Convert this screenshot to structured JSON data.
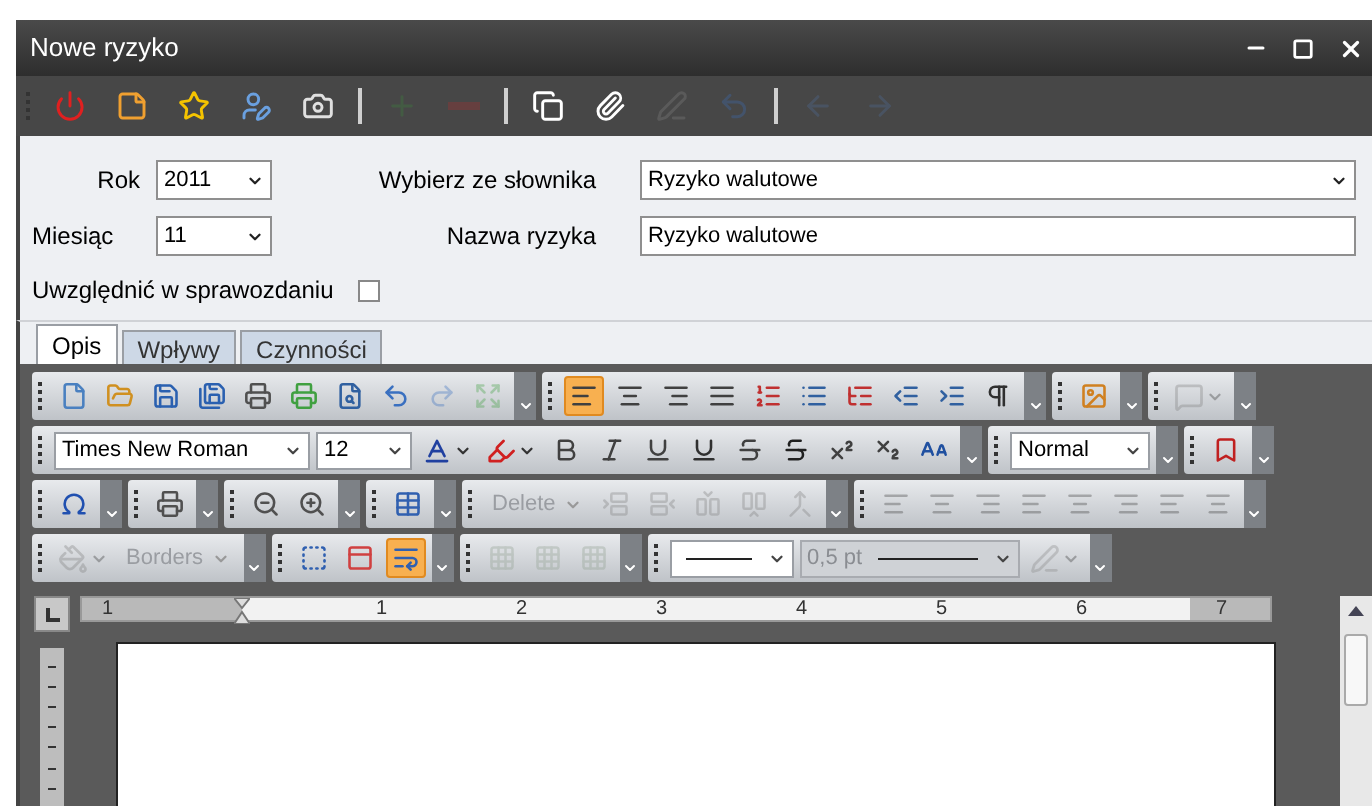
{
  "window": {
    "title": "Nowe ryzyko"
  },
  "main_toolbar": [
    {
      "kind": "button",
      "disabled": false
    },
    {
      "kind": "button",
      "disabled": false
    },
    {
      "kind": "button",
      "disabled": false
    },
    {
      "kind": "button",
      "disabled": false
    },
    {
      "kind": "button",
      "disabled": false
    },
    {
      "kind": "separator"
    },
    {
      "kind": "button",
      "disabled": true
    },
    {
      "kind": "button",
      "disabled": true
    },
    {
      "kind": "separator"
    },
    {
      "kind": "button",
      "disabled": false
    },
    {
      "kind": "button",
      "disabled": false
    },
    {
      "kind": "button",
      "disabled": true
    },
    {
      "kind": "button",
      "disabled": true
    },
    {
      "kind": "separator"
    },
    {
      "kind": "button",
      "disabled": true
    },
    {
      "kind": "button",
      "disabled": true
    }
  ],
  "form": {
    "year": {
      "label": "Rok",
      "value": "2011"
    },
    "month": {
      "label": "Miesiąc",
      "value": "11"
    },
    "dictionary": {
      "label": "Wybierz ze słownika",
      "value": "Ryzyko walutowe"
    },
    "name": {
      "label": "Nazwa ryzyka",
      "value": "Ryzyko walutowe"
    },
    "include": {
      "label": "Uwzględnić w sprawozdaniu",
      "checked": false
    }
  },
  "tabs": [
    {
      "label": "Opis",
      "selected": true
    },
    {
      "label": "Wpływy",
      "selected": false
    },
    {
      "label": "Czynności",
      "selected": false
    }
  ],
  "editor_toolbars": [
    [
      [
        {
          "kind": "button",
          "active": false,
          "disabled": false
        },
        {
          "kind": "button",
          "active": false,
          "disabled": false
        },
        {
          "kind": "button",
          "active": false,
          "disabled": false
        },
        {
          "kind": "button",
          "active": false,
          "disabled": false
        },
        {
          "kind": "button",
          "active": false,
          "disabled": false
        },
        {
          "kind": "button",
          "active": false,
          "disabled": false
        },
        {
          "kind": "button",
          "active": false,
          "disabled": false
        },
        {
          "kind": "button",
          "active": false,
          "disabled": false
        },
        {
          "kind": "button",
          "active": false,
          "disabled": true
        },
        {
          "kind": "button",
          "active": false,
          "disabled": true
        }
      ],
      [
        {
          "kind": "button",
          "active": true,
          "disabled": false
        },
        {
          "kind": "button",
          "active": false,
          "disabled": false
        },
        {
          "kind": "button",
          "active": false,
          "disabled": false
        },
        {
          "kind": "button",
          "active": false,
          "disabled": false
        },
        {
          "kind": "button",
          "active": false,
          "disabled": false
        },
        {
          "kind": "button",
          "active": false,
          "disabled": false
        },
        {
          "kind": "button",
          "active": false,
          "disabled": false
        },
        {
          "kind": "button",
          "active": false,
          "disabled": false
        },
        {
          "kind": "button",
          "active": false,
          "disabled": false
        },
        {
          "kind": "button",
          "active": false,
          "disabled": false
        }
      ],
      [
        {
          "kind": "button",
          "active": false,
          "disabled": false
        }
      ],
      [
        {
          "kind": "split",
          "active": false,
          "disabled": true
        }
      ]
    ],
    [
      [
        {
          "kind": "combo",
          "value": "Times New Roman",
          "disabled": false
        },
        {
          "kind": "combo",
          "value": "12",
          "disabled": false
        },
        {
          "kind": "split",
          "active": false,
          "disabled": false
        },
        {
          "kind": "split",
          "active": false,
          "disabled": false
        },
        {
          "kind": "button",
          "active": false,
          "disabled": false
        },
        {
          "kind": "button",
          "active": false,
          "disabled": false
        },
        {
          "kind": "button",
          "active": false,
          "disabled": false
        },
        {
          "kind": "button",
          "active": false,
          "disabled": false
        },
        {
          "kind": "button",
          "active": false,
          "disabled": false
        },
        {
          "kind": "button",
          "active": false,
          "disabled": false
        },
        {
          "kind": "button",
          "active": false,
          "disabled": false
        },
        {
          "kind": "button",
          "active": false,
          "disabled": false
        },
        {
          "kind": "button",
          "active": false,
          "disabled": false
        }
      ],
      [
        {
          "kind": "combo",
          "value": "Normal",
          "disabled": false
        }
      ],
      [
        {
          "kind": "button",
          "active": false,
          "disabled": false
        }
      ]
    ],
    [
      [
        {
          "kind": "button",
          "active": false,
          "disabled": false
        }
      ],
      [
        {
          "kind": "button",
          "active": false,
          "disabled": false
        }
      ],
      [
        {
          "kind": "button",
          "active": false,
          "disabled": false
        },
        {
          "kind": "button",
          "active": false,
          "disabled": false
        }
      ],
      [
        {
          "kind": "button",
          "active": false,
          "disabled": false
        }
      ],
      [
        {
          "kind": "menu",
          "label": "Delete",
          "disabled": true
        },
        {
          "kind": "button",
          "active": false,
          "disabled": true
        },
        {
          "kind": "button",
          "active": false,
          "disabled": true
        },
        {
          "kind": "button",
          "active": false,
          "disabled": true
        },
        {
          "kind": "button",
          "active": false,
          "disabled": true
        },
        {
          "kind": "button",
          "active": false,
          "disabled": true
        }
      ],
      [
        {
          "kind": "button",
          "active": false,
          "disabled": true
        },
        {
          "kind": "button",
          "active": false,
          "disabled": true
        },
        {
          "kind": "button",
          "active": false,
          "disabled": true
        },
        {
          "kind": "button",
          "active": false,
          "disabled": true
        },
        {
          "kind": "button",
          "active": false,
          "disabled": true
        },
        {
          "kind": "button",
          "active": false,
          "disabled": true
        },
        {
          "kind": "button",
          "active": false,
          "disabled": true
        },
        {
          "kind": "button",
          "active": false,
          "disabled": true
        }
      ]
    ],
    [
      [
        {
          "kind": "split",
          "active": false,
          "disabled": true
        },
        {
          "kind": "menu",
          "label": "Borders",
          "disabled": true
        }
      ],
      [
        {
          "kind": "button",
          "active": false,
          "disabled": false
        },
        {
          "kind": "button",
          "active": false,
          "disabled": false
        },
        {
          "kind": "button",
          "active": true,
          "disabled": false
        }
      ],
      [
        {
          "kind": "button",
          "active": false,
          "disabled": true
        },
        {
          "kind": "button",
          "active": false,
          "disabled": true
        },
        {
          "kind": "button",
          "active": false,
          "disabled": true
        }
      ],
      [
        {
          "kind": "line-combo",
          "disabled": false
        },
        {
          "kind": "combo",
          "value": "0,5 pt",
          "disabled": true
        },
        {
          "kind": "split",
          "active": false,
          "disabled": true
        }
      ]
    ]
  ],
  "ruler": {
    "labels": [
      "1",
      "1",
      "2",
      "3",
      "4",
      "5",
      "6",
      "7"
    ]
  }
}
